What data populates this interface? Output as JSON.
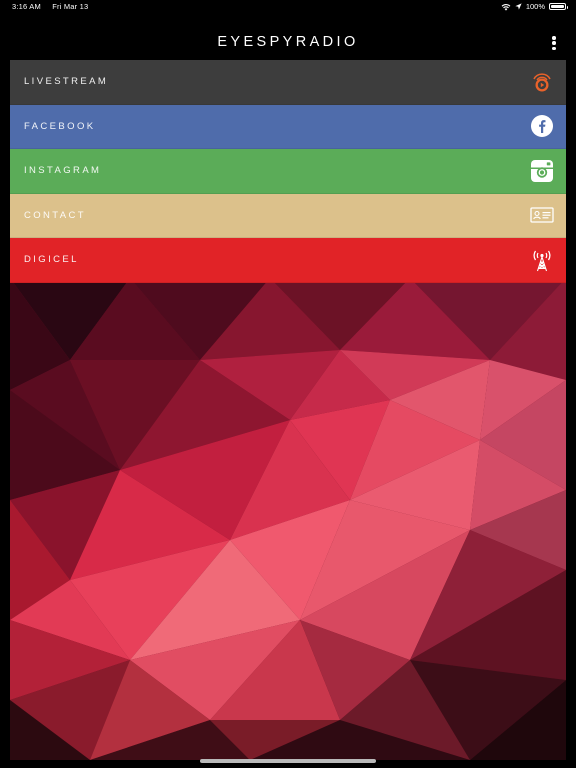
{
  "status_bar": {
    "time": "3:16 AM",
    "date": "Fri Mar 13",
    "battery": "100%"
  },
  "nav": {
    "title": "EYESPYRADIO"
  },
  "menu": [
    {
      "label": "LIVESTREAM",
      "color": "#3d3d3d",
      "icon": "radio-eye-icon"
    },
    {
      "label": "FACEBOOK",
      "color": "#4f6cab",
      "icon": "facebook-icon"
    },
    {
      "label": "INSTAGRAM",
      "color": "#5bac58",
      "icon": "instagram-icon"
    },
    {
      "label": "CONTACT",
      "color": "#dcc18b",
      "icon": "contact-card-icon"
    },
    {
      "label": "DIGICEL",
      "color": "#e12327",
      "icon": "radio-tower-icon"
    }
  ],
  "colors": {
    "background": "#000000",
    "accent_orange": "#e9622a",
    "polygon_dark": "#5b0d20",
    "polygon_light": "#e96170"
  }
}
